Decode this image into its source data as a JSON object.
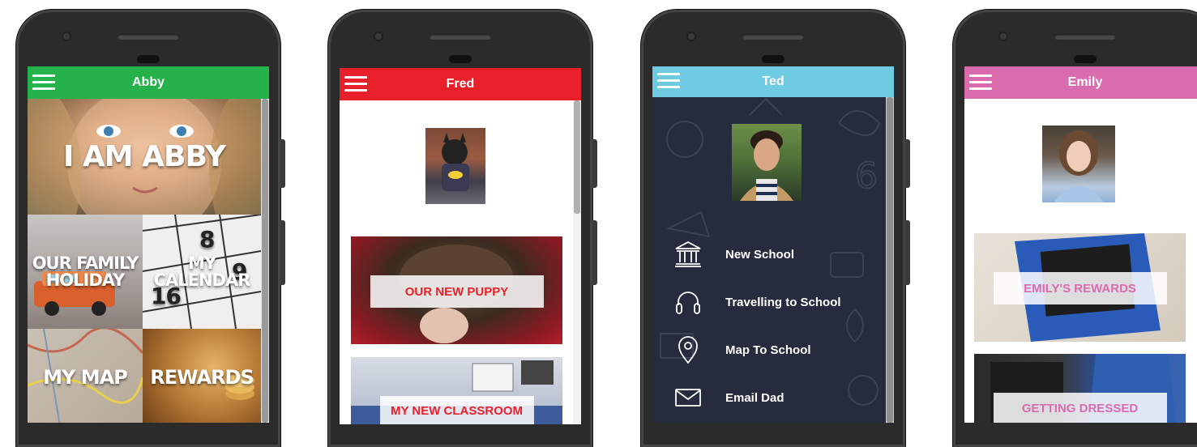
{
  "phones": {
    "abby": {
      "title": "Abby",
      "accent": "#26b24b",
      "hero_label": "I AM ABBY",
      "tiles": [
        {
          "label": "OUR FAMILY HOLIDAY"
        },
        {
          "label": "MY CALENDAR"
        },
        {
          "label": "MY MAP"
        },
        {
          "label": "REWARDS"
        }
      ]
    },
    "fred": {
      "title": "Fred",
      "accent": "#e8202a",
      "cards": [
        {
          "label": "OUR NEW PUPPY"
        },
        {
          "label": "MY NEW CLASSROOM"
        }
      ]
    },
    "ted": {
      "title": "Ted",
      "accent": "#6ecbe2",
      "background": "#262b3d",
      "menu": [
        {
          "label": "New School",
          "icon": "bank-icon"
        },
        {
          "label": "Travelling to School",
          "icon": "headphones-icon"
        },
        {
          "label": "Map To School",
          "icon": "location-pin-icon"
        },
        {
          "label": "Email Dad",
          "icon": "envelope-icon"
        }
      ]
    },
    "emily": {
      "title": "Emily",
      "accent": "#d96bae",
      "cards": [
        {
          "label": "EMILY'S REWARDS"
        },
        {
          "label": "GETTING DRESSED"
        }
      ]
    }
  }
}
